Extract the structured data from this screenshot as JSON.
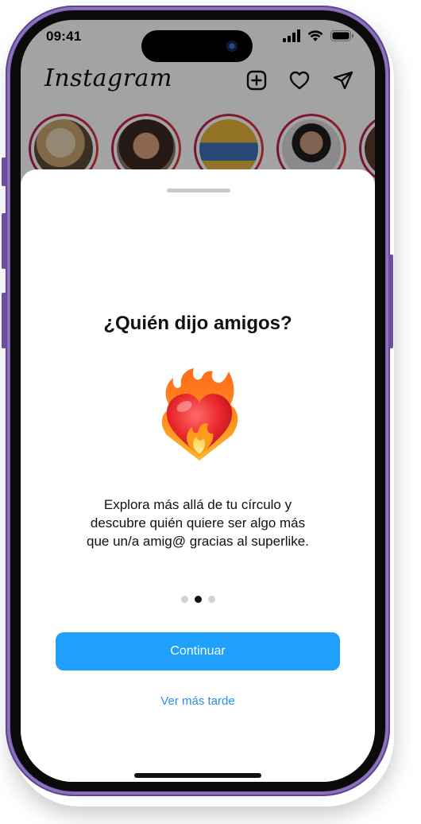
{
  "status_bar": {
    "time": "09:41",
    "icons": [
      "signal-icon",
      "wifi-icon",
      "battery-icon"
    ]
  },
  "app_header": {
    "logo_text": "Instagram",
    "icons": [
      "add-post-icon",
      "heart-icon",
      "direct-message-icon"
    ]
  },
  "stories": {
    "count_visible": 5
  },
  "sheet": {
    "title": "¿Quién dijo amigos?",
    "illustration_icon": "heart-on-fire-icon",
    "description_lines": [
      "Explora más allá de tu círculo y",
      "descubre quién quiere ser algo más",
      "que un/a amig@ gracias al superlike."
    ],
    "pagination": {
      "total": 3,
      "active_index": 1
    },
    "primary_button_label": "Continuar",
    "secondary_link_label": "Ver más tarde"
  },
  "colors": {
    "frame": "#7b5fae",
    "primary_button": "#1fa1fb",
    "link": "#2c8fe6",
    "story_ring": "#c8264a",
    "dot_active": "#111111",
    "dot_inactive": "#d2d2d2"
  }
}
